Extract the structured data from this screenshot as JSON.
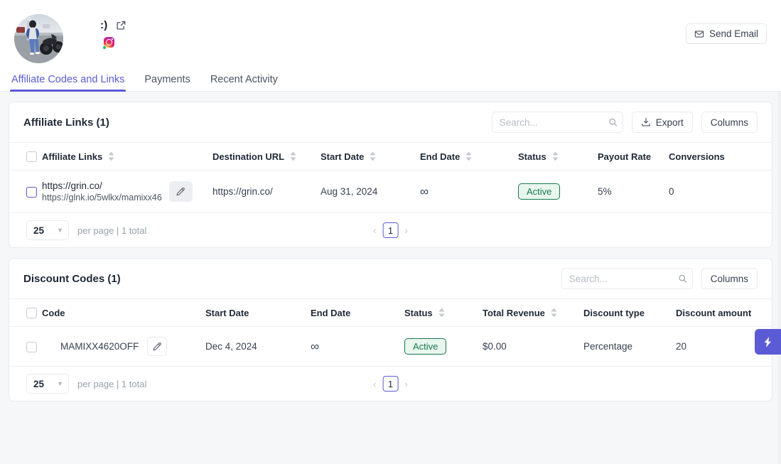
{
  "header": {
    "profile_name": ":)",
    "avatar_alt": "profile-photo",
    "external_link_icon": "external-link-icon",
    "instagram_icon": "instagram-icon",
    "online_badge": "online-status-dot",
    "send_email_label": "Send Email",
    "mail_icon": "mail-icon"
  },
  "tabs": [
    {
      "label": "Affiliate Codes and Links",
      "active": true
    },
    {
      "label": "Payments",
      "active": false
    },
    {
      "label": "Recent Activity",
      "active": false
    }
  ],
  "affiliate_links_card": {
    "title": "Affiliate Links (1)",
    "search_placeholder": "Search...",
    "search_value": "",
    "export_label": "Export",
    "columns_label": "Columns",
    "headers": [
      {
        "label": "Affiliate Links",
        "sortable": true
      },
      {
        "label": "Destination URL",
        "sortable": true
      },
      {
        "label": "Start Date",
        "sortable": true
      },
      {
        "label": "End Date",
        "sortable": true
      },
      {
        "label": "Status",
        "sortable": true
      },
      {
        "label": "Payout Rate",
        "sortable": false
      },
      {
        "label": "Conversions",
        "sortable": false
      }
    ],
    "rows": [
      {
        "link_main": "https://grin.co/",
        "link_sub": "https://glnk.io/5wlkx/mamixx46",
        "destination_url": "https://grin.co/",
        "start_date": "Aug 31, 2024",
        "end_date": "∞",
        "status": "Active",
        "payout_rate": "5%",
        "conversions": "0"
      }
    ],
    "pagination": {
      "per_page": "25",
      "label": "per page | 1 total",
      "prev": "‹",
      "page": "1",
      "next": "›"
    }
  },
  "discount_codes_card": {
    "title": "Discount Codes (1)",
    "search_placeholder": "Search...",
    "search_value": "",
    "columns_label": "Columns",
    "headers": [
      {
        "label": "Code",
        "sortable": false
      },
      {
        "label": "Start Date",
        "sortable": false
      },
      {
        "label": "End Date",
        "sortable": false
      },
      {
        "label": "Status",
        "sortable": true
      },
      {
        "label": "Total Revenue",
        "sortable": true
      },
      {
        "label": "Discount type",
        "sortable": false
      },
      {
        "label": "Discount amount",
        "sortable": false
      }
    ],
    "rows": [
      {
        "code": "MAMIXX4620OFF",
        "start_date": "Dec 4, 2024",
        "end_date": "∞",
        "status": "Active",
        "total_revenue": "$0.00",
        "discount_type": "Percentage",
        "discount_amount": "20"
      }
    ],
    "pagination": {
      "per_page": "25",
      "label": "per page | 1 total",
      "prev": "‹",
      "page": "1",
      "next": "›"
    }
  },
  "flash_tab": {
    "icon": "lightning-bolt-icon"
  },
  "colors": {
    "accent": "#5b5bd6",
    "status_green_text": "#18794e",
    "status_green_bg": "#e9f6ee",
    "page_bg": "#f6f7f9",
    "border": "#e8eaee"
  }
}
